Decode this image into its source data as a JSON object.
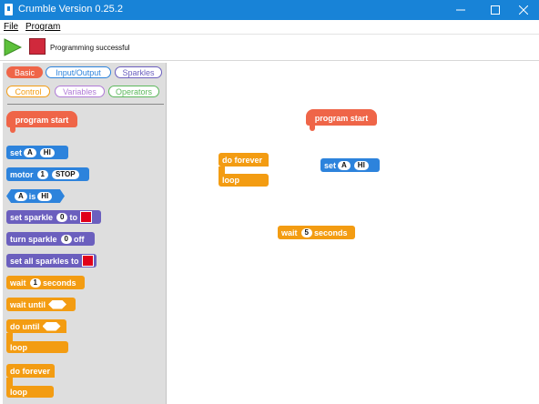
{
  "window": {
    "title": "Crumble Version 0.25.2",
    "minimize": "—",
    "maximize": "☐",
    "close": "✕"
  },
  "menu": {
    "file": "File",
    "program": "Program"
  },
  "toolbar": {
    "status": "Programming successful"
  },
  "categories": [
    "Basic",
    "Input/Output",
    "Sparkles",
    "Control",
    "Variables",
    "Operators"
  ],
  "palette": {
    "program_start": "program start",
    "set": {
      "label": "set",
      "pin": "A",
      "value": "HI"
    },
    "motor": {
      "label": "motor",
      "num": "1",
      "state": "STOP"
    },
    "is": {
      "pin": "A",
      "label": "is",
      "value": "HI"
    },
    "set_sparkle": {
      "label": "set sparkle",
      "num": "0",
      "to": "to"
    },
    "turn_sparkle": {
      "label": "turn sparkle",
      "num": "0",
      "off": "off"
    },
    "set_all": "set all sparkles to",
    "wait": {
      "label": "wait",
      "num": "1",
      "unit": "seconds"
    },
    "wait_until": "wait until",
    "do_until": {
      "label": "do until",
      "loop": "loop"
    },
    "do_forever": {
      "label": "do forever",
      "loop": "loop"
    }
  },
  "workspace": {
    "program_start": "program start",
    "set": {
      "label": "set",
      "pin": "A",
      "value": "HI"
    },
    "do_forever": {
      "label": "do forever",
      "loop": "loop"
    },
    "wait": {
      "label": "wait",
      "num": "5",
      "unit": "seconds"
    }
  },
  "colors": {
    "titlebar": "#1883d7",
    "hat": "#ef6548",
    "io": "#2d83dc",
    "sparkle": "#6b5fbe",
    "control": "#f39c12",
    "sparkle_color": "#e0001b"
  }
}
